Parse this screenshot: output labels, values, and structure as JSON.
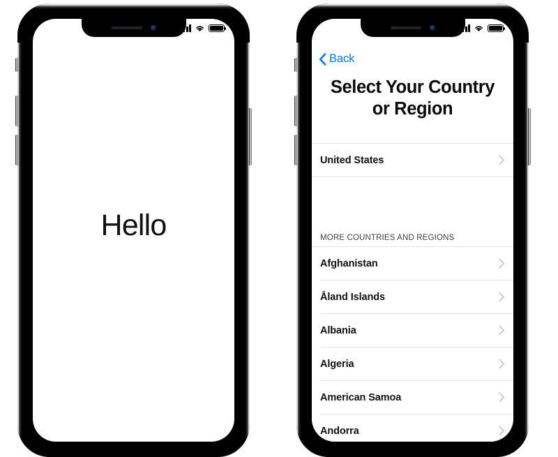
{
  "theme": {
    "accent_blue": "#007aff",
    "text_primary": "#111111",
    "text_secondary": "#3f3f3f",
    "separator": "#e2e2e2",
    "chevron_gray": "#c7c7cc",
    "screen_bg": "#ffffff",
    "frame_black": "#0a0a0a"
  },
  "phones": [
    {
      "id": "phone-hello",
      "status_bar": {
        "cellular_icon": "cellular-bars-icon",
        "wifi_icon": "wifi-icon",
        "battery_icon": "battery-full-icon",
        "bars_count": 4
      },
      "screen": {
        "greeting": "Hello"
      }
    },
    {
      "id": "phone-country-picker",
      "status_bar": {
        "cellular_icon": "cellular-bars-icon",
        "wifi_icon": "wifi-icon",
        "battery_icon": "battery-full-icon",
        "bars_count": 4
      },
      "screen": {
        "nav": {
          "back_label": "Back",
          "back_icon": "chevron-left-icon"
        },
        "title_line1": "Select Your Country",
        "title_line2": "or Region",
        "suggested": {
          "items": [
            {
              "label": "United States",
              "accessory_icon": "chevron-right-icon"
            }
          ]
        },
        "section_header": "MORE COUNTRIES AND REGIONS",
        "countries": [
          {
            "label": "Afghanistan",
            "accessory_icon": "chevron-right-icon"
          },
          {
            "label": "Åland Islands",
            "accessory_icon": "chevron-right-icon"
          },
          {
            "label": "Albania",
            "accessory_icon": "chevron-right-icon"
          },
          {
            "label": "Algeria",
            "accessory_icon": "chevron-right-icon"
          },
          {
            "label": "American Samoa",
            "accessory_icon": "chevron-right-icon"
          },
          {
            "label": "Andorra",
            "accessory_icon": "chevron-right-icon"
          }
        ]
      },
      "hardware": {
        "power_button": "power-button",
        "volume_up_button": "volume-up-button",
        "volume_down_button": "volume-down-button",
        "ring_silent_switch": "ring-silent-switch"
      }
    }
  ]
}
